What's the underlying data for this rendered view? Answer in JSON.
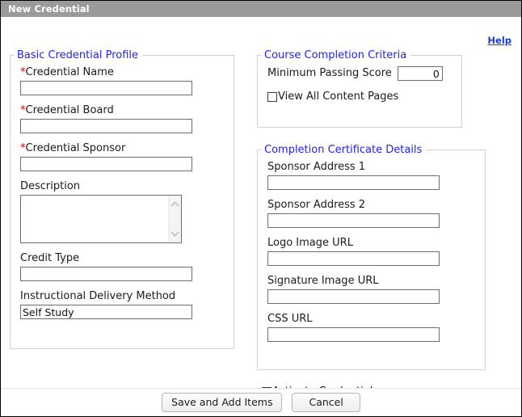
{
  "window": {
    "title": "New Credential"
  },
  "help": {
    "label": "Help"
  },
  "basic_profile": {
    "legend": "Basic Credential Profile",
    "fields": [
      {
        "label": "Credential Name",
        "required": true,
        "value": "",
        "type": "text"
      },
      {
        "label": "Credential Board",
        "required": true,
        "value": "",
        "type": "text"
      },
      {
        "label": "Credential Sponsor",
        "required": true,
        "value": "",
        "type": "text"
      },
      {
        "label": "Description",
        "required": false,
        "value": "",
        "type": "textarea"
      },
      {
        "label": "Credit Type",
        "required": false,
        "value": "",
        "type": "text"
      },
      {
        "label": "Instructional Delivery Method",
        "required": false,
        "value": "Self Study",
        "type": "text"
      }
    ],
    "required_marker": "*"
  },
  "course_completion": {
    "legend": "Course Completion Criteria",
    "min_passing_score_label": "Minimum Passing Score",
    "min_passing_score_value": "0",
    "view_all_content_pages_label": "View All Content Pages",
    "view_all_content_pages_checked": false
  },
  "certificate_details": {
    "legend": "Completion Certificate Details",
    "fields": [
      {
        "label": "Sponsor Address 1",
        "value": ""
      },
      {
        "label": "Sponsor Address 2",
        "value": ""
      },
      {
        "label": "Logo Image URL",
        "value": ""
      },
      {
        "label": "Signature Image URL",
        "value": ""
      },
      {
        "label": "CSS URL",
        "value": ""
      }
    ]
  },
  "activate": {
    "label": "Activate Credential",
    "checked": false
  },
  "footer": {
    "save_label": "Save and Add Items",
    "cancel_label": "Cancel"
  },
  "colors": {
    "titlebar_bg": "#9a9a9a",
    "legend_blue": "#2222ee",
    "required_red": "#d40000",
    "link_blue": "#1a3fd0",
    "fieldset_border": "#d2d2d2",
    "input_border": "#6d6d6d"
  }
}
